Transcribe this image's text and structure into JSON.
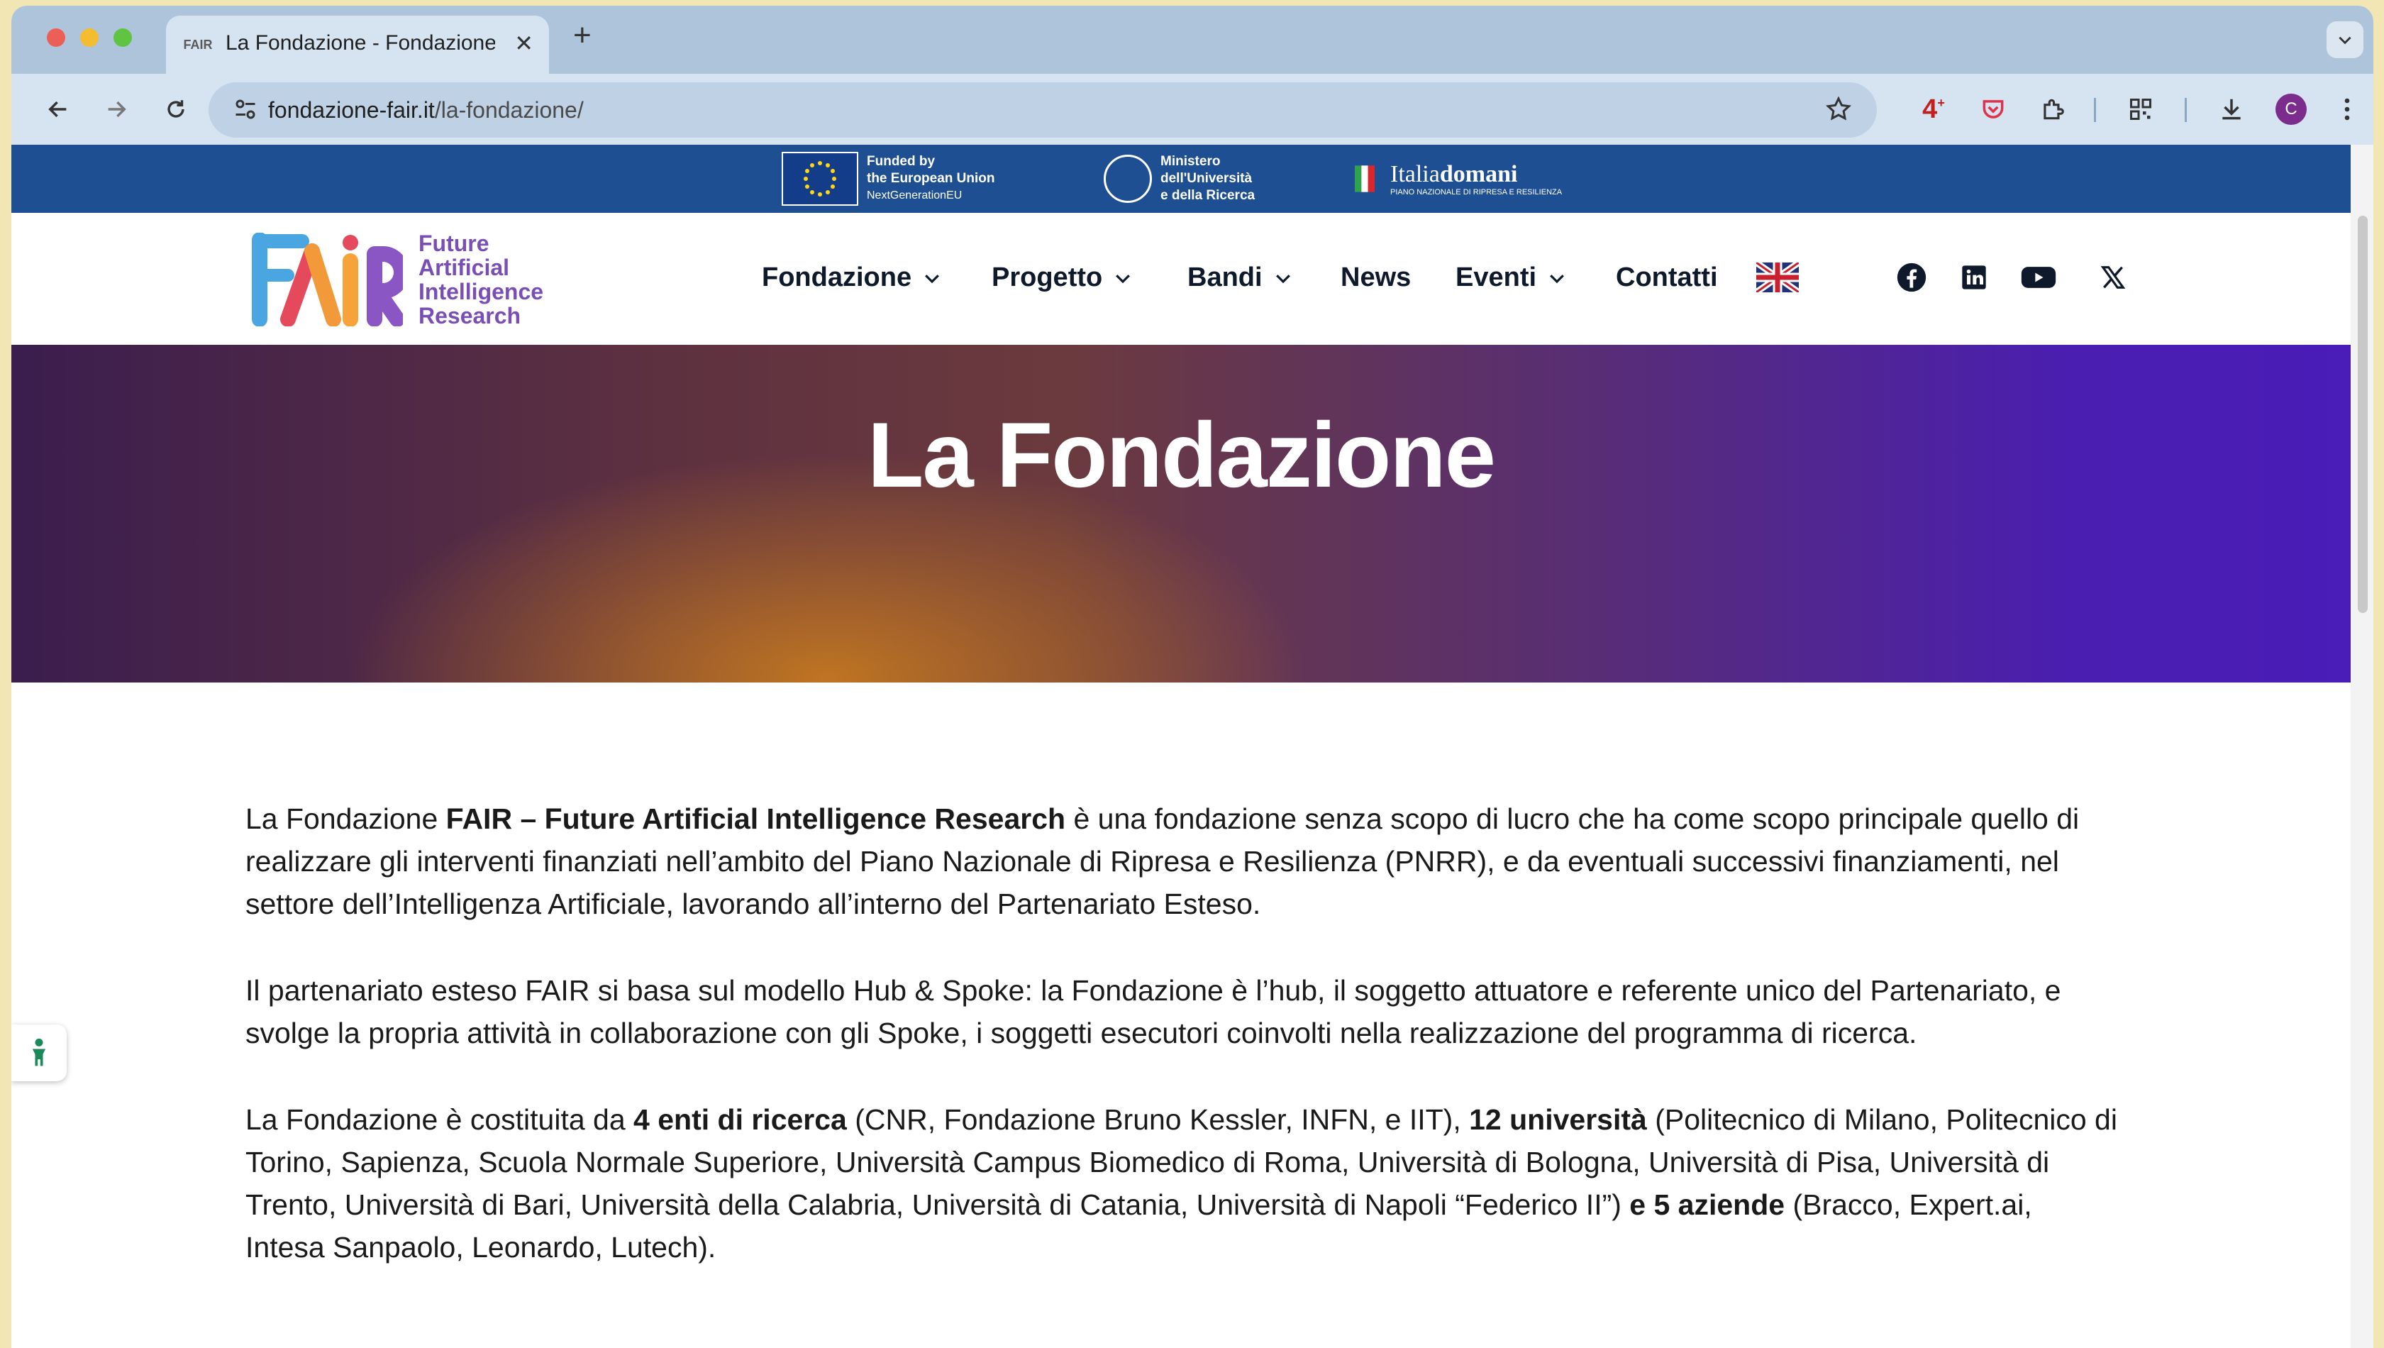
{
  "browser": {
    "tab_title": "La Fondazione - Fondazione F",
    "tab_favicon": "FAIR",
    "url_domain": "fondazione-fair.it",
    "url_path": "/la-fondazione/",
    "extension_badge": "4",
    "avatar_letter": "C"
  },
  "eu_band": {
    "eu_line1": "Funded by",
    "eu_line2": "the European Union",
    "eu_line3": "NextGenerationEU",
    "mur_line1": "Ministero",
    "mur_line2": "dell'Università",
    "mur_line3": "e della Ricerca",
    "italia_name_a": "Italia",
    "italia_name_b": "domani",
    "italia_sub": "PIANO NAZIONALE DI RIPRESA E RESILIENZA"
  },
  "logo": {
    "line1": "Future",
    "line2": "Artificial",
    "line3": "Intelligence",
    "line4": "Research"
  },
  "nav": {
    "items": [
      {
        "label": "Fondazione"
      },
      {
        "label": "Progetto"
      },
      {
        "label": "Bandi"
      },
      {
        "label": "News"
      },
      {
        "label": "Eventi"
      },
      {
        "label": "Contatti"
      }
    ]
  },
  "hero": {
    "title": "La Fondazione"
  },
  "content": {
    "p1_a": "La Fondazione ",
    "p1_b": "FAIR – Future Artificial Intelligence Research",
    "p1_c": " è una fondazione senza scopo di lucro che ha come scopo principale quello di realizzare gli interventi finanziati nell’ambito del Piano Nazionale di Ripresa e Resilienza (PNRR), e da eventuali successivi finanziamenti, nel settore dell’Intelligenza Artificiale, lavorando all’interno del Partenariato Esteso.",
    "p2": "Il partenariato esteso FAIR si basa sul modello Hub & Spoke: la Fondazione è l’hub, il soggetto attuatore e referente unico del Partenariato, e svolge la propria attività in collaborazione con gli Spoke, i soggetti esecutori coinvolti nella realizzazione del programma di ricerca.",
    "p3_a": "La Fondazione è costituita da ",
    "p3_b": "4 enti di ricerca",
    "p3_c": "  (CNR, Fondazione Bruno Kessler, INFN, e IIT), ",
    "p3_d": "12 università",
    "p3_e": " (Politecnico di Milano, Politecnico di Torino, Sapienza, Scuola Normale Superiore, Università Campus Biomedico di Roma, Università di Bologna, Università di Pisa, Università di Trento, Università di Bari, Università della Calabria, Università di Catania, Università di Napoli “Federico II”) ",
    "p3_f": "e 5 aziende",
    "p3_g": " (Bracco, Expert.ai, Intesa Sanpaolo, Leonardo, Lutech)."
  },
  "colors": {
    "eu_band": "#1d4f92",
    "logo_text": "#7a4fb5",
    "nav_text": "#0e1a2b"
  }
}
